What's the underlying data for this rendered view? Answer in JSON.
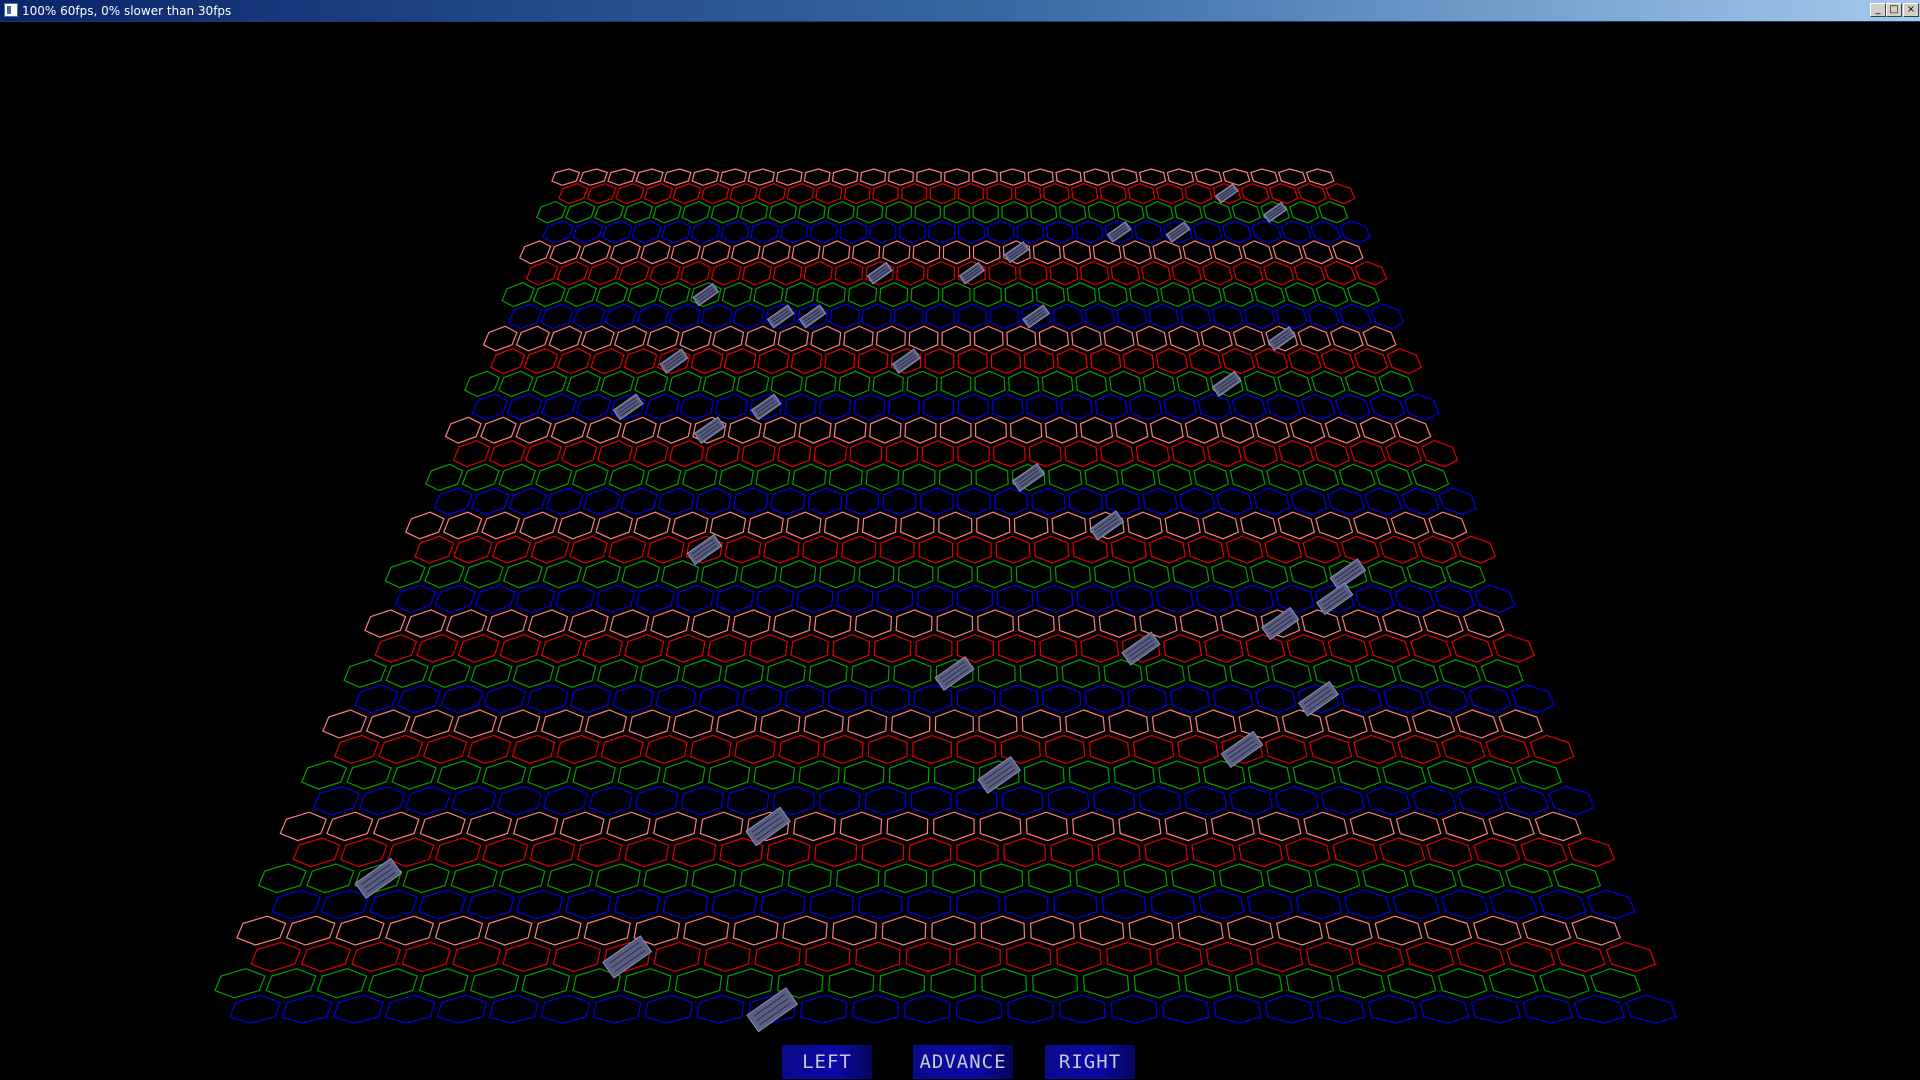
{
  "window": {
    "title": "100% 60fps, 0% slower than 30fps",
    "minimize_glyph": "_",
    "maximize_glyph": "□",
    "close_glyph": "×"
  },
  "board": {
    "columns": 28,
    "rows": 36,
    "row_colors": [
      "#ff7f7f",
      "#e00000",
      "#00a000",
      "#0000e8"
    ],
    "marker_color": "#5a5f82",
    "units": [
      [
        23,
        1
      ],
      [
        25,
        2
      ],
      [
        19,
        3
      ],
      [
        21,
        3
      ],
      [
        16,
        4
      ],
      [
        11,
        5
      ],
      [
        14,
        5
      ],
      [
        6,
        6
      ],
      [
        9,
        7
      ],
      [
        8,
        7
      ],
      [
        16,
        7
      ],
      [
        24,
        8
      ],
      [
        5,
        9
      ],
      [
        12,
        9
      ],
      [
        22,
        10
      ],
      [
        8,
        11
      ],
      [
        4,
        11
      ],
      [
        7,
        12
      ],
      [
        16,
        14
      ],
      [
        18,
        16
      ],
      [
        7,
        17
      ],
      [
        24,
        18
      ],
      [
        23,
        19
      ],
      [
        22,
        20
      ],
      [
        18,
        21
      ],
      [
        14,
        22
      ],
      [
        22,
        23
      ],
      [
        20,
        25
      ],
      [
        15,
        26
      ],
      [
        10,
        28
      ],
      [
        2,
        30
      ],
      [
        7,
        33
      ],
      [
        10,
        35
      ]
    ]
  },
  "controls": {
    "left_label": "LEFT",
    "advance_label": "ADVANCE",
    "right_label": "RIGHT"
  }
}
